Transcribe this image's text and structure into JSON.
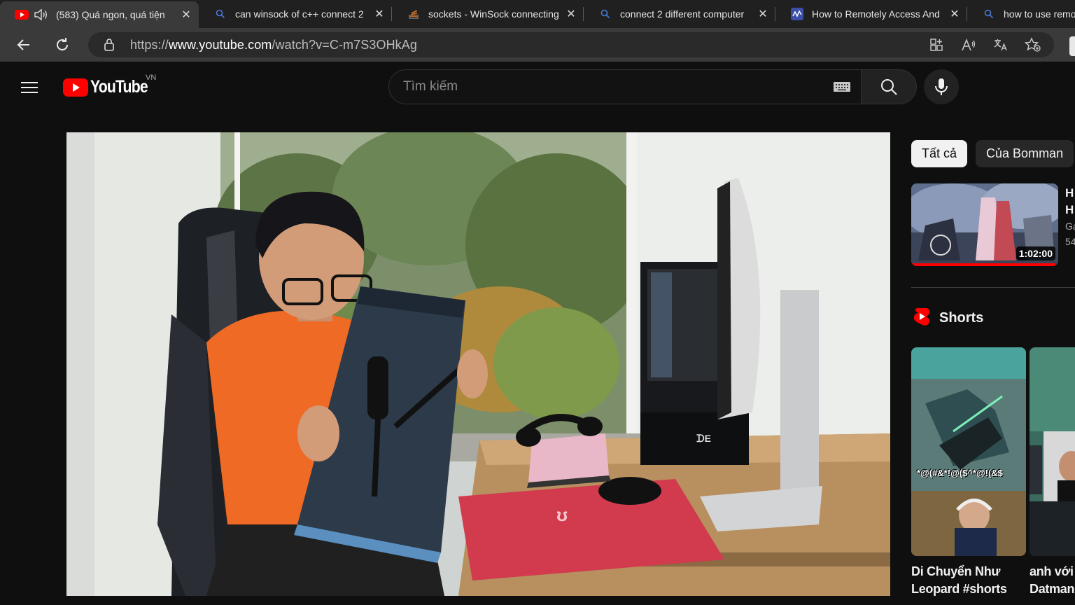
{
  "browser": {
    "tabs": [
      {
        "title": "(583) Quá ngon, quá tiện",
        "favicon": "youtube-icon",
        "active": true,
        "audio": true
      },
      {
        "title": "can winsock of c++ connect 2",
        "favicon": "search-icon",
        "active": false
      },
      {
        "title": "sockets - WinSock connecting",
        "favicon": "stackoverflow-icon",
        "active": false
      },
      {
        "title": "connect 2 different computer",
        "favicon": "search-icon",
        "active": false
      },
      {
        "title": "How to Remotely Access And",
        "favicon": "site-icon",
        "active": false
      },
      {
        "title": "how to use remo",
        "favicon": "search-icon",
        "active": false
      }
    ],
    "close_glyph": "✕",
    "url_prefix": "https://",
    "url_host": "www.youtube.com",
    "url_path": "/watch?v=C-m7S3OHkAg"
  },
  "youtube": {
    "logo_text": "YouTube",
    "region": "VN",
    "search_placeholder": "Tìm kiếm",
    "chips": [
      {
        "label": "Tất cả",
        "active": true
      },
      {
        "label": "Của Bomman",
        "active": false
      }
    ],
    "recommended": {
      "title_lines": [
        "H",
        "H"
      ],
      "channel": "Ga",
      "views": "54",
      "duration": "1:02:00",
      "watched_fraction": 0.98
    },
    "shorts_label": "Shorts",
    "shorts": [
      {
        "title_lines": [
          "Di Chuyển Như",
          "Leopard #shorts"
        ],
        "overlay_text": "*@(#&*!@($^*@!(&$"
      },
      {
        "title_lines": [
          "anh với",
          "Datmani"
        ]
      }
    ]
  },
  "colors": {
    "youtube_red": "#ff0000",
    "page_bg": "#0f0f0f",
    "chip_bg": "#272727"
  }
}
